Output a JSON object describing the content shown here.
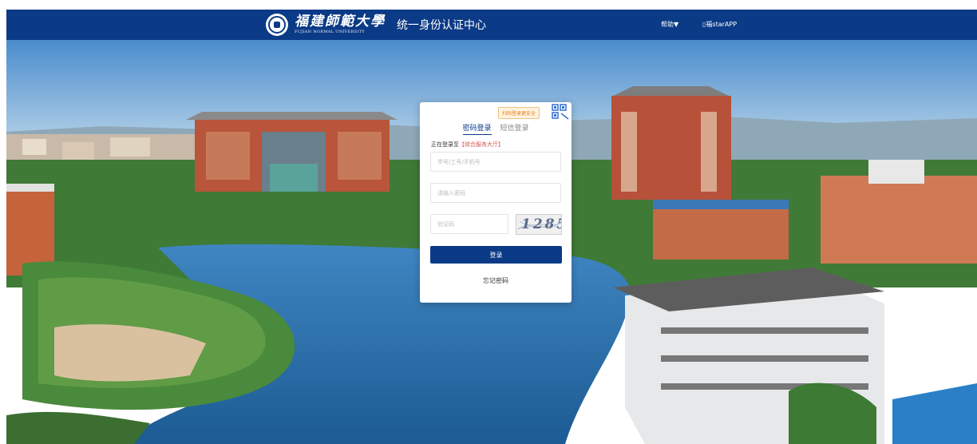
{
  "header": {
    "brand_cn": "福建師範大學",
    "brand_en": "FUJIAN NORMAL UNIVERSITY",
    "portal_title": "统一身份认证中心",
    "help_label": "帮助▼",
    "app_label": "▯福starAPP",
    "background_color": "#0b3a86"
  },
  "login": {
    "qr_tip": "扫码登录更安全",
    "qr_icon": "qr-code-icon",
    "tab_password": "密码登录",
    "tab_sms": "短信登录",
    "logging_prefix": "正在登录至",
    "logging_target": "【综合服务大厅】",
    "username_placeholder": "学号/工号/手机号",
    "password_placeholder": "请输入密码",
    "captcha_placeholder": "验证码",
    "captcha_text": "1285",
    "login_button": "登录",
    "forgot_password": "忘记密码",
    "accent_color": "#0b3a86"
  }
}
